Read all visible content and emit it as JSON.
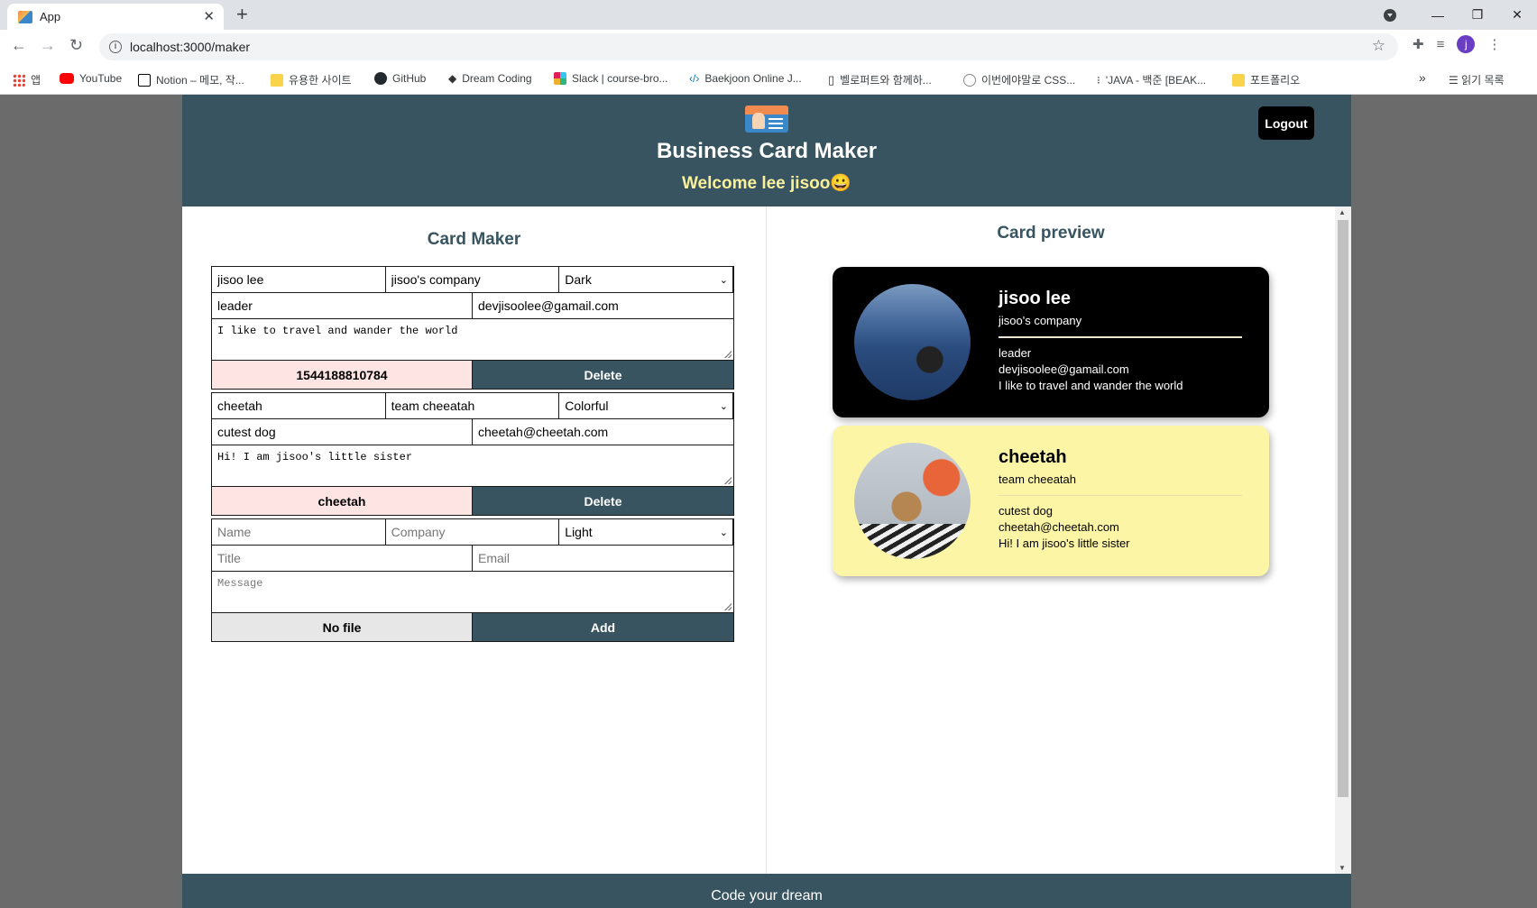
{
  "browser": {
    "tab_title": "App",
    "url": "localhost:3000/maker",
    "avatar_letter": "j",
    "bookmarks": [
      {
        "label": "앱",
        "color": "#ea4335"
      },
      {
        "label": "YouTube",
        "color": "#ff0000"
      },
      {
        "label": "Notion – 메모, 작...",
        "color": "#000000"
      },
      {
        "label": "유용한 사이트",
        "color": "#f9d349"
      },
      {
        "label": "GitHub",
        "color": "#24292e"
      },
      {
        "label": "Dream Coding",
        "color": "#333333"
      },
      {
        "label": "Slack | course-bro...",
        "color": "#4a154b"
      },
      {
        "label": "Baekjoon Online J...",
        "color": "#0076c0"
      },
      {
        "label": "벨로퍼트와 함께하...",
        "color": "#333333"
      },
      {
        "label": "이번에야말로 CSS...",
        "color": "#888888"
      },
      {
        "label": "'JAVA - 백준 [BEAK...",
        "color": "#333333"
      },
      {
        "label": "포트폴리오",
        "color": "#f9d349"
      }
    ],
    "more_label": "»",
    "reading_list_label": "읽기 목록"
  },
  "header": {
    "title": "Business Card Maker",
    "welcome": "Welcome lee jisoo😀",
    "logout_label": "Logout"
  },
  "maker": {
    "title": "Card Maker",
    "cards": [
      {
        "name": "jisoo lee",
        "company": "jisoo's company",
        "theme": "Dark",
        "title": "leader",
        "email": "devjisoolee@gamail.com",
        "message": "I like to travel and wander the world",
        "file_label": "1544188810784",
        "action_label": "Delete"
      },
      {
        "name": "cheetah",
        "company": "team cheeatah",
        "theme": "Colorful",
        "title": "cutest dog",
        "email": "cheetah@cheetah.com",
        "message": "Hi! I am jisoo's little sister",
        "file_label": "cheetah",
        "action_label": "Delete"
      }
    ],
    "new_card": {
      "name_placeholder": "Name",
      "company_placeholder": "Company",
      "theme": "Light",
      "title_placeholder": "Title",
      "email_placeholder": "Email",
      "message_placeholder": "Message",
      "file_label": "No file",
      "action_label": "Add"
    },
    "theme_options": [
      "Light",
      "Dark",
      "Colorful"
    ]
  },
  "preview": {
    "title": "Card preview",
    "cards": [
      {
        "name": "jisoo lee",
        "company": "jisoo's company",
        "title": "leader",
        "email": "devjisoolee@gamail.com",
        "message": "I like to travel and wander the world",
        "theme": "dark"
      },
      {
        "name": "cheetah",
        "company": "team cheeatah",
        "title": "cutest dog",
        "email": "cheetah@cheetah.com",
        "message": "Hi! I am jisoo's little sister",
        "theme": "colorful"
      }
    ]
  },
  "footer": {
    "text": "Code your dream"
  },
  "colors": {
    "primary": "#385461",
    "welcome": "#f9f09a",
    "dark_card": "#000000",
    "colorful_card": "#fdf5a6",
    "file_pink": "#ffe4e4"
  }
}
